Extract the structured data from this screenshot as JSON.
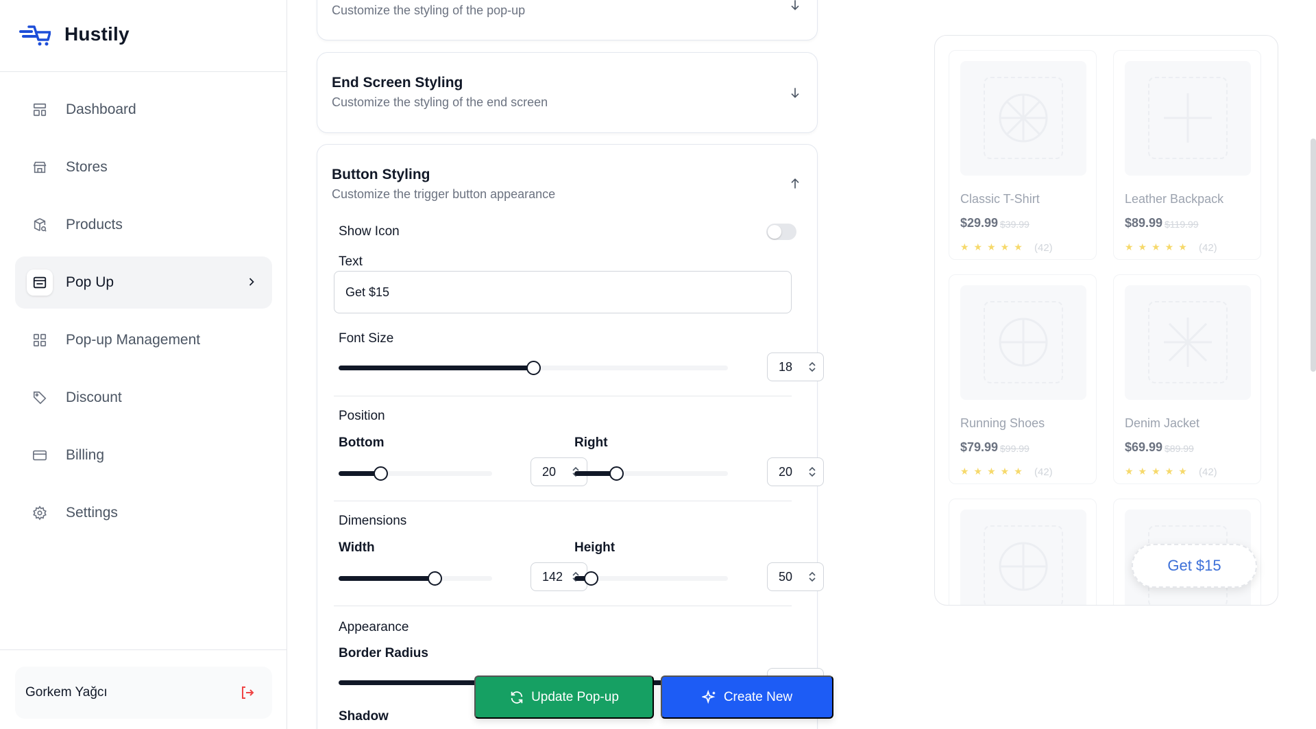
{
  "app": {
    "name": "Hustily"
  },
  "sidebar": {
    "items": [
      {
        "label": "Dashboard",
        "icon": "dashboard-icon"
      },
      {
        "label": "Stores",
        "icon": "store-icon"
      },
      {
        "label": "Products",
        "icon": "package-search-icon"
      },
      {
        "label": "Pop Up",
        "icon": "popup-icon",
        "active": true
      },
      {
        "label": "Pop-up Management",
        "icon": "grid-icon"
      },
      {
        "label": "Discount",
        "icon": "tag-icon"
      },
      {
        "label": "Billing",
        "icon": "credit-card-icon"
      },
      {
        "label": "Settings",
        "icon": "gear-icon"
      }
    ],
    "user": {
      "name": "Gorkem Yağcı"
    }
  },
  "panels": {
    "popup_styling": {
      "subtitle": "Customize the styling of the pop-up"
    },
    "end_screen": {
      "title": "End Screen Styling",
      "subtitle": "Customize the styling of the end screen"
    },
    "button_styling": {
      "title": "Button Styling",
      "subtitle": "Customize the trigger button appearance",
      "show_icon_label": "Show Icon",
      "show_icon_value": false,
      "text_label": "Text",
      "text_value": "Get $15",
      "font_size_label": "Font Size",
      "font_size_value": "18",
      "position_label": "Position",
      "bottom_label": "Bottom",
      "bottom_value": "20",
      "right_label": "Right",
      "right_value": "20",
      "dimensions_label": "Dimensions",
      "width_label": "Width",
      "width_value": "142",
      "height_label": "Height",
      "height_value": "50",
      "appearance_label": "Appearance",
      "border_radius_label": "Border Radius",
      "shadow_label": "Shadow"
    }
  },
  "actions": {
    "update_label": "Update Pop-up",
    "create_label": "Create New"
  },
  "preview": {
    "products": [
      {
        "name": "Classic T-Shirt",
        "price": "$29.99",
        "old_price": "$39.99",
        "reviews": "(42)"
      },
      {
        "name": "Leather Backpack",
        "price": "$89.99",
        "old_price": "$119.99",
        "reviews": "(42)"
      },
      {
        "name": "Running Shoes",
        "price": "$79.99",
        "old_price": "$99.99",
        "reviews": "(42)"
      },
      {
        "name": "Denim Jacket",
        "price": "$69.99",
        "old_price": "$89.99",
        "reviews": "(42)"
      }
    ],
    "stars": "★★★★★",
    "trigger_button": "Get $15"
  },
  "colors": {
    "primary_green": "#16a063",
    "primary_blue": "#1d5cf5",
    "logout_red": "#ef4444"
  }
}
